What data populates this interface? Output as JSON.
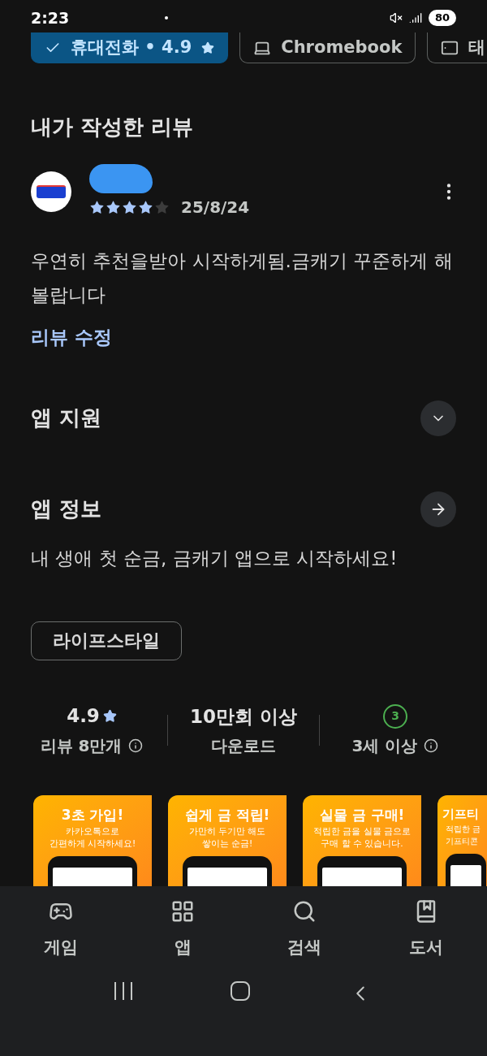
{
  "status_bar": {
    "time": "2:23",
    "battery": "80"
  },
  "device_chips": [
    {
      "label": "휴대전화 • 4.9",
      "kind": "phone",
      "selected": true
    },
    {
      "label": "Chromebook",
      "kind": "laptop",
      "selected": false
    },
    {
      "label": "태",
      "kind": "tablet",
      "selected": false
    }
  ],
  "my_review": {
    "title": "내가 작성한 리뷰",
    "stars": 4,
    "date": "25/8/24",
    "text": "우연히 추천을받아 시작하게됨.금캐기 꾸준하게 해볼랍니다",
    "edit_link": "리뷰 수정"
  },
  "sections": [
    {
      "title": "앱 지원",
      "kind": "expand"
    },
    {
      "title": "앱 정보",
      "kind": "arrow"
    }
  ],
  "app_description": "내 생애 첫 순금, 금캐기 앱으로 시작하세요!",
  "category_chip": "라이프스타일",
  "stats": [
    {
      "kind": "rating",
      "value": "4.9",
      "label": "리뷰 8만개",
      "info": true
    },
    {
      "kind": "text",
      "value": "10만회 이상",
      "label": "다운로드",
      "info": false
    },
    {
      "kind": "age",
      "value": "3",
      "label": "3세 이상",
      "info": true
    }
  ],
  "screenshots": [
    {
      "title": "3초 가입!",
      "subtitle": [
        "카카오톡으로",
        "간편하게 시작하세요!"
      ]
    },
    {
      "title": "쉽게 금 적립!",
      "subtitle": [
        "가만히 두기만 해도",
        "쌓이는 순금!"
      ]
    },
    {
      "title": "실물 금 구매!",
      "subtitle": [
        "적립한 금을 실물 금으로",
        "구매 할 수 있습니다."
      ]
    },
    {
      "title": "기프티",
      "subtitle": [
        "적립한 금",
        "기프티콘"
      ]
    }
  ],
  "bottom_nav": [
    {
      "label": "게임",
      "kind": "games"
    },
    {
      "label": "앱",
      "kind": "apps"
    },
    {
      "label": "검색",
      "kind": "search"
    },
    {
      "label": "도서",
      "kind": "books"
    }
  ]
}
